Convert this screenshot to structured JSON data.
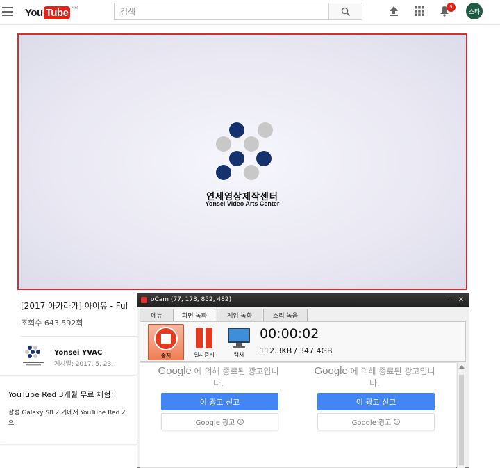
{
  "header": {
    "logo_you": "You",
    "logo_tube": "Tube",
    "logo_region": "KR",
    "search_placeholder": "검색",
    "notification_count": "5",
    "avatar_text": "스타",
    "icons": [
      "menu-icon",
      "search-icon",
      "upload-icon",
      "apps-grid-icon",
      "bell-icon"
    ]
  },
  "video": {
    "logo_title": "연세영상제작센터",
    "logo_subtitle": "Yonsei Video Arts Center",
    "title": "[2017 아카라카] 아이유 - Ful",
    "views": "조회수 643,592회"
  },
  "channel": {
    "name": "Yonsei YVAC",
    "date": "게시일: 2017. 5. 23."
  },
  "promo": {
    "title": "YouTube Red 3개월 무료 체험!",
    "desc_line1": "삼성 Galaxy S8 기기에서 YouTube Red 가",
    "desc_line2": "요."
  },
  "ocam": {
    "title": "oCam (77, 173, 852, 482)",
    "tabs": [
      "메뉴",
      "화면 녹화",
      "게임 녹화",
      "소리 녹음"
    ],
    "active_tab": "화면 녹화",
    "buttons": {
      "stop": "중지",
      "pause": "일시중지",
      "capture": "캡처"
    },
    "timer": "00:00:02",
    "file_size": "112.3KB / 347.4GB",
    "ads": [
      {
        "brand": "Google",
        "text1": " 에 의해 종료된 광고입니",
        "text2": "다.",
        "report": "이 광고 신고",
        "google_ads": "Google 광고"
      },
      {
        "brand": "Google",
        "text1": " 에 의해 종료된 광고입니",
        "text2": "다.",
        "report": "이 광고 신고",
        "google_ads": "Google 광고"
      }
    ]
  },
  "colors": {
    "youtube_red": "#e62117",
    "player_border": "#d32f2f",
    "yvac_blue": "#15326e",
    "ad_button_blue": "#4285f4",
    "ocam_stop": "#f07e57",
    "avatar_green": "#1e5a44"
  }
}
